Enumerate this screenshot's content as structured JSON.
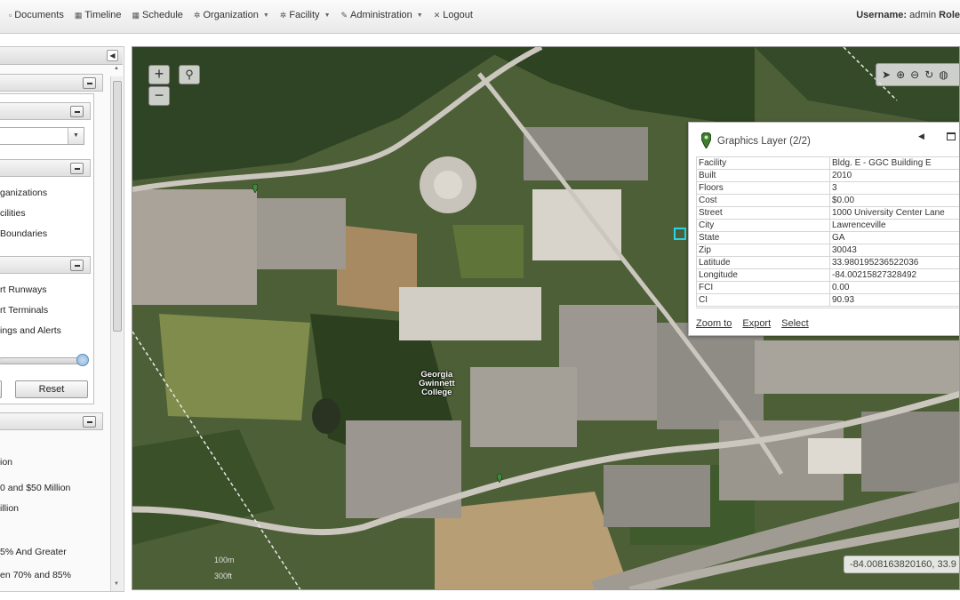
{
  "nav": {
    "items": [
      {
        "label": "Documents",
        "icon": "document-icon"
      },
      {
        "label": "Timeline",
        "icon": "calendar-icon"
      },
      {
        "label": "Schedule",
        "icon": "calendar-icon"
      },
      {
        "label": "Organization",
        "icon": "gear-icon",
        "dropdown": true
      },
      {
        "label": "Facility",
        "icon": "gear-icon",
        "dropdown": true
      },
      {
        "label": "Administration",
        "icon": "wrench-icon",
        "dropdown": true
      },
      {
        "label": "Logout",
        "icon": "close-icon"
      }
    ],
    "username_label": "Username:",
    "username": "admin",
    "role_label": "Role"
  },
  "sidebar": {
    "layers": [
      "ganizations",
      "cilities",
      "Boundaries"
    ],
    "layers2": [
      "rt Runways",
      "rt Terminals",
      "ings and Alerts"
    ],
    "reset_label": "Reset",
    "legend": [
      "ion",
      "0 and $50 Million",
      "illion",
      "5% And Greater",
      "en 70% and 85%"
    ]
  },
  "map": {
    "campus_label": [
      "Georgia",
      "Gwinnett",
      "College"
    ],
    "coords": "-84.008163820160, 33.9",
    "scale_top": "100m",
    "scale_bottom": "300ft",
    "zoom_in": "+",
    "zoom_out": "−"
  },
  "popup": {
    "title": "Graphics Layer (2/2)",
    "rows": [
      {
        "key": "Facility",
        "value": "Bldg. E - GGC Building E"
      },
      {
        "key": "Built",
        "value": "2010"
      },
      {
        "key": "Floors",
        "value": "3"
      },
      {
        "key": "Cost",
        "value": "$0.00"
      },
      {
        "key": "Street",
        "value": "1000 University Center Lane"
      },
      {
        "key": "City",
        "value": "Lawrenceville"
      },
      {
        "key": "State",
        "value": "GA"
      },
      {
        "key": "Zip",
        "value": "30043"
      },
      {
        "key": "Latitude",
        "value": "33.980195236522036"
      },
      {
        "key": "Longitude",
        "value": "-84.00215827328492"
      },
      {
        "key": "FCI",
        "value": "0.00"
      },
      {
        "key": "CI",
        "value": "90.93"
      }
    ],
    "links": [
      "Zoom to",
      "Export",
      "Select"
    ]
  },
  "colors": {
    "map_green": "#3f5a2c",
    "pavement": "#b9b5ad",
    "highlight": "#28d4e6"
  }
}
